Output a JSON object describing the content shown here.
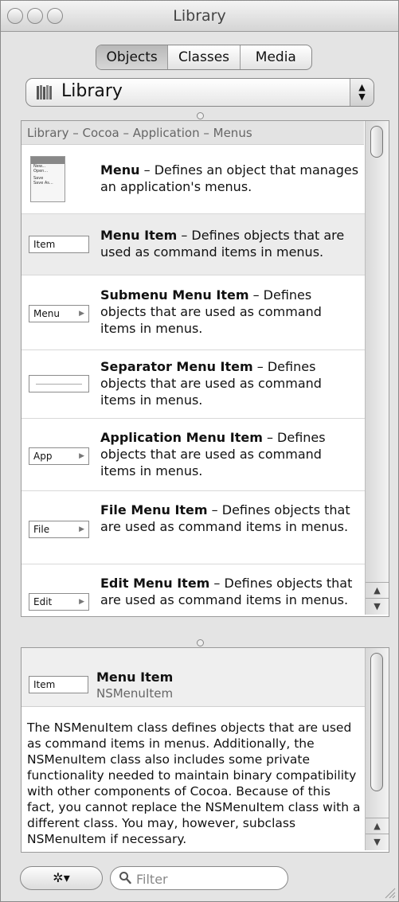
{
  "window": {
    "title": "Library"
  },
  "tabs": [
    {
      "label": "Objects"
    },
    {
      "label": "Classes"
    },
    {
      "label": "Media"
    }
  ],
  "popup": {
    "value": "Library"
  },
  "breadcrumb": "Library – Cocoa – Application – Menus",
  "items": [
    {
      "icon_text": "",
      "name": "Menu",
      "desc": " – Defines an object that manages an application's menus."
    },
    {
      "icon_text": "Item",
      "name": "Menu Item",
      "desc": " – Defines objects that are used as command items in menus."
    },
    {
      "icon_text": "Menu",
      "name": "Submenu Menu Item",
      "desc": " – Defines objects that are used as command items in menus."
    },
    {
      "icon_text": "",
      "name": "Separator Menu Item",
      "desc": " – Defines objects that are used as command items in menus."
    },
    {
      "icon_text": "App",
      "name": "Application Menu Item",
      "desc": " – Defines objects that are used as command items in menus."
    },
    {
      "icon_text": "File",
      "name": "File Menu Item",
      "desc": " – Defines objects that are used as command items in menus."
    },
    {
      "icon_text": "Edit",
      "name": "Edit Menu Item",
      "desc": " – Defines objects that are used as command items in menus."
    }
  ],
  "menu_icon_lines": [
    "New...",
    "Open...",
    "Save",
    "Save As..."
  ],
  "detail": {
    "icon_text": "Item",
    "name": "Menu Item",
    "class_name": "NSMenuItem",
    "description": "The NSMenuItem class defines objects that are used as command items in menus. Additionally, the NSMenuItem class also includes some private functionality needed to maintain binary compatibility with other components of Cocoa. Because of this fact, you cannot replace the NSMenuItem class with a different class. You may, however, subclass NSMenuItem if necessary."
  },
  "footer": {
    "gear_label": "✲▾",
    "filter_placeholder": "Filter"
  }
}
